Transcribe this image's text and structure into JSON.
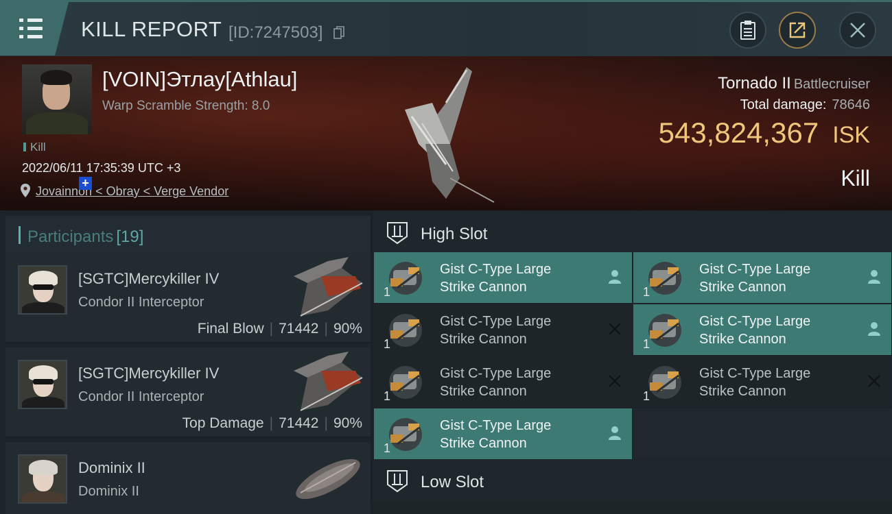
{
  "header": {
    "title": "KILL REPORT",
    "kill_id": "[ID:7247503]",
    "icons": [
      "menu-icon",
      "copy-icon",
      "clipboard-icon",
      "share-icon",
      "close-icon"
    ]
  },
  "victim": {
    "name": "[VOIN]Этлау[Athlau]",
    "warp_scramble": "Warp Scramble Strength: 8.0",
    "tag": "Kill",
    "datetime": "2022/06/11 17:35:39 UTC +3",
    "location": "Jovainnon < Obray < Verge Vendor",
    "ship_name": "Tornado II",
    "ship_class": "Battlecruiser",
    "total_damage_label": "Total damage:",
    "total_damage": "78646",
    "isk_value": "543,824,367",
    "isk_unit": "ISK",
    "result": "Kill"
  },
  "participants": {
    "label": "Participants",
    "count": "[19]",
    "rows": [
      {
        "name": "[SGTC]Mercykiller IV",
        "ship": "Condor II Interceptor",
        "role": "Final Blow",
        "damage": "71442",
        "percent": "90%"
      },
      {
        "name": "[SGTC]Mercykiller IV",
        "ship": "Condor II Interceptor",
        "role": "Top Damage",
        "damage": "71442",
        "percent": "90%"
      },
      {
        "name": "Dominix II",
        "ship": "Dominix II",
        "role": "",
        "damage": "",
        "percent": ""
      }
    ]
  },
  "slots": {
    "high_label": "High Slot",
    "low_label": "Low Slot",
    "modules": [
      {
        "line1": "Gist C-Type Large",
        "line2": "Strike Cannon",
        "qty": "1",
        "status": "fitted"
      },
      {
        "line1": "Gist C-Type Large",
        "line2": "Strike Cannon",
        "qty": "1",
        "status": "fitted"
      },
      {
        "line1": "Gist C-Type Large",
        "line2": "Strike Cannon",
        "qty": "1",
        "status": "destroyed"
      },
      {
        "line1": "Gist C-Type Large",
        "line2": "Strike Cannon",
        "qty": "1",
        "status": "fitted"
      },
      {
        "line1": "Gist C-Type Large",
        "line2": "Strike Cannon",
        "qty": "1",
        "status": "destroyed"
      },
      {
        "line1": "Gist C-Type Large",
        "line2": "Strike Cannon",
        "qty": "1",
        "status": "destroyed"
      },
      {
        "line1": "Gist C-Type Large",
        "line2": "Strike Cannon",
        "qty": "1",
        "status": "fitted"
      }
    ]
  },
  "colors": {
    "accent_teal": "#3e7a74",
    "isk_gold": "#f0c77a",
    "participant_accent": "#5bb4b0"
  }
}
